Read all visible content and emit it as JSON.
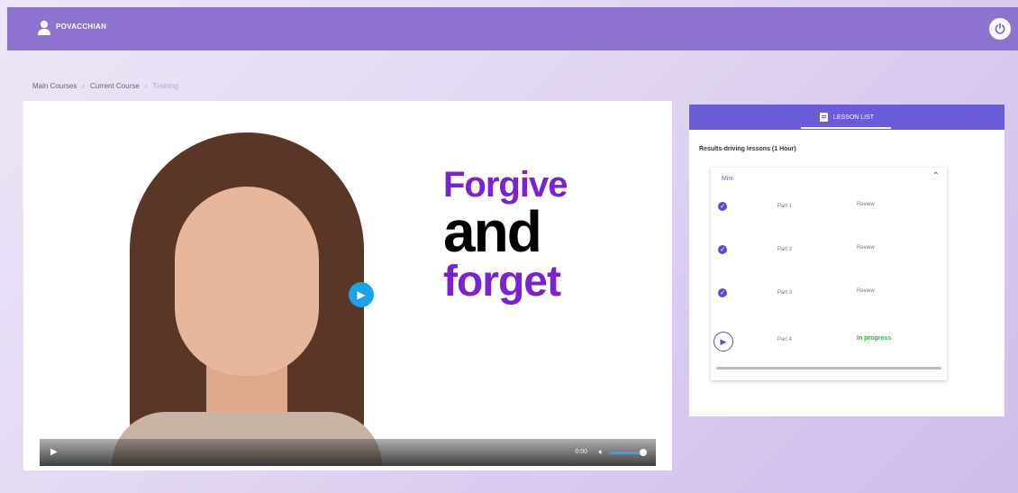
{
  "topbar": {
    "username": "POVACCHIAN",
    "power_icon": "power-icon",
    "color": "#8e72d0"
  },
  "breadcrumb": {
    "items": [
      "Main Courses",
      "Current Course",
      "Training"
    ],
    "separator": "›"
  },
  "video": {
    "slogan": [
      "Forgive",
      "and",
      "forget"
    ],
    "slogan_colors": [
      "#7a22cf",
      "#000000",
      "#7a22cf"
    ],
    "time": "0:00",
    "play_icon": "play-icon",
    "volume_icon": "volume-icon",
    "volume_level": 0.8
  },
  "lesson_panel": {
    "tab_label": "LESSON LIST",
    "course_title": "Results-driving lessons (1 Hour)",
    "section_label": "Mini",
    "parts": [
      {
        "name": "Part 1",
        "status": "Review",
        "state": "done"
      },
      {
        "name": "Part 2",
        "status": "Review",
        "state": "done"
      },
      {
        "name": "Part 3",
        "status": "Review",
        "state": "done"
      },
      {
        "name": "Part 4",
        "status": "In progress",
        "state": "current"
      }
    ],
    "accent": "#6a5bd8"
  }
}
